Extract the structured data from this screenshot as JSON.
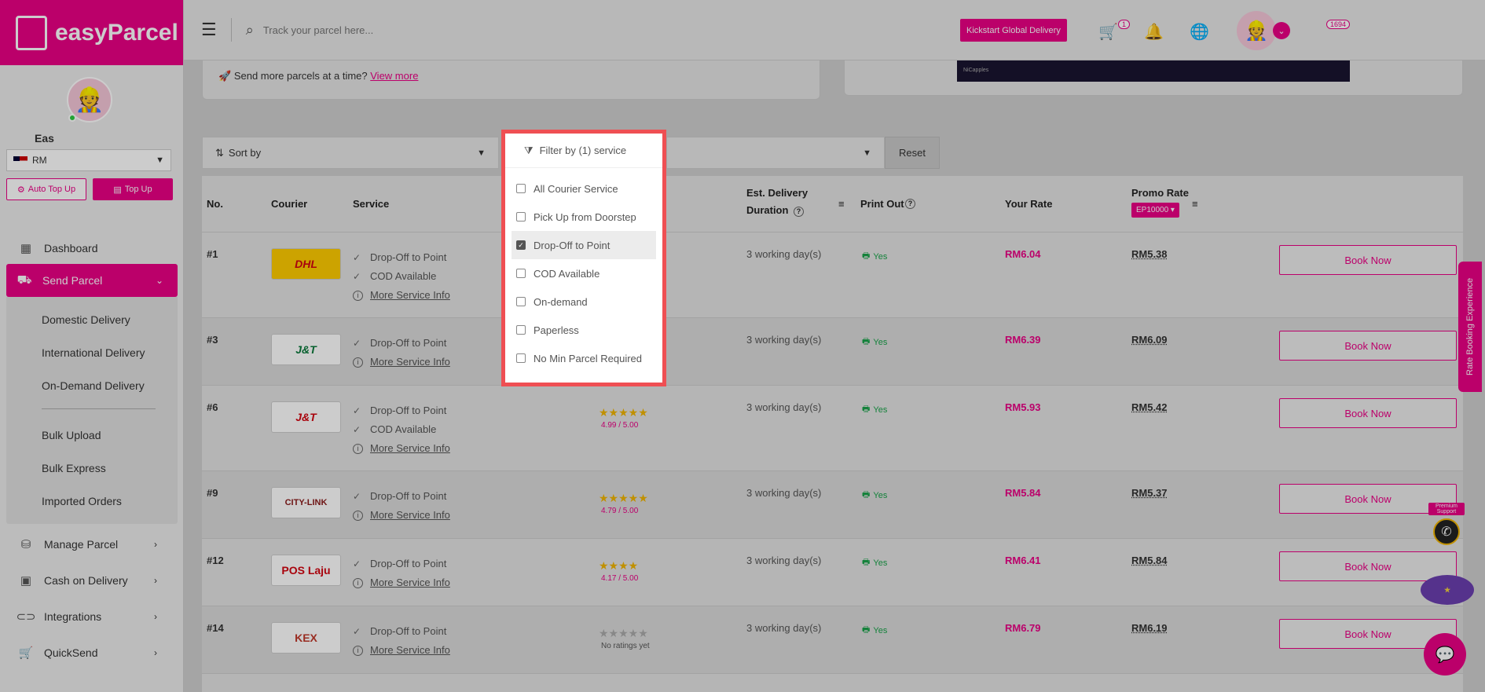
{
  "header": {
    "brand": "easyParcel",
    "search_placeholder": "Track your parcel here...",
    "kickstart_label": "Kickstart Global Delivery",
    "cart_count": "1",
    "notification_count": "1694"
  },
  "sidebar": {
    "user_name": "Eas",
    "currency": "RM",
    "auto_topup": "Auto Top Up",
    "topup": "Top Up",
    "items": [
      {
        "label": "Dashboard"
      },
      {
        "label": "Send Parcel"
      },
      {
        "label": "Manage Parcel"
      },
      {
        "label": "Cash on Delivery"
      },
      {
        "label": "Integrations"
      },
      {
        "label": "QuickSend"
      }
    ],
    "sub_items": [
      {
        "label": "Domestic Delivery"
      },
      {
        "label": "International Delivery"
      },
      {
        "label": "On-Demand Delivery"
      },
      {
        "label": "Bulk Upload"
      },
      {
        "label": "Bulk Express"
      },
      {
        "label": "Imported Orders"
      }
    ]
  },
  "bulk_note": {
    "text": "Send more parcels at a time?",
    "link": "View more"
  },
  "banner_text": "NiCapples",
  "toolbar": {
    "sort_label": "Sort by",
    "reset_label": "Reset"
  },
  "filter": {
    "label": "Filter by (1) service",
    "options": [
      {
        "label": "All Courier Service",
        "checked": false
      },
      {
        "label": "Pick Up from Doorstep",
        "checked": false
      },
      {
        "label": "Drop-Off to Point",
        "checked": true
      },
      {
        "label": "COD Available",
        "checked": false
      },
      {
        "label": "On-demand",
        "checked": false
      },
      {
        "label": "Paperless",
        "checked": false
      },
      {
        "label": "No Min Parcel Required",
        "checked": false
      }
    ]
  },
  "table": {
    "headers": {
      "no": "No.",
      "courier": "Courier",
      "service": "Service",
      "est1": "Est. Delivery",
      "est2": "Duration",
      "print": "Print Out",
      "rate": "Your Rate",
      "promo": "Promo Rate",
      "promo_code": "EP10000"
    },
    "rows": [
      {
        "no": "#1",
        "courier": "DHL eCommerce",
        "services": [
          "Drop-Off to Point",
          "COD Available"
        ],
        "more": "More Service Info",
        "stars": "",
        "rating": "",
        "duration": "3 working day(s)",
        "print": "Yes",
        "rate": "RM6.04",
        "promo": "RM5.38",
        "book": "Book Now"
      },
      {
        "no": "#3",
        "courier": "J&T CARGO",
        "services": [
          "Drop-Off to Point"
        ],
        "more": "More Service Info",
        "stars": "",
        "rating": "",
        "duration": "3 working day(s)",
        "print": "Yes",
        "rate": "RM6.39",
        "promo": "RM6.09",
        "book": "Book Now"
      },
      {
        "no": "#6",
        "courier": "J&T EXPRESS",
        "services": [
          "Drop-Off to Point",
          "COD Available"
        ],
        "more": "More Service Info",
        "stars": "★★★★★",
        "rating": "4.99 / 5.00",
        "duration": "3 working day(s)",
        "print": "Yes",
        "rate": "RM5.93",
        "promo": "RM5.42",
        "book": "Book Now"
      },
      {
        "no": "#9",
        "courier": "CITY-LINK",
        "services": [
          "Drop-Off to Point"
        ],
        "more": "More Service Info",
        "stars": "★★★★★",
        "rating": "4.79 / 5.00",
        "duration": "3 working day(s)",
        "print": "Yes",
        "rate": "RM5.84",
        "promo": "RM5.37",
        "book": "Book Now"
      },
      {
        "no": "#12",
        "courier": "POS Laju",
        "services": [
          "Drop-Off to Point"
        ],
        "more": "More Service Info",
        "stars": "★★★★",
        "rating": "4.17 / 5.00",
        "duration": "3 working day(s)",
        "print": "Yes",
        "rate": "RM6.41",
        "promo": "RM5.84",
        "book": "Book Now"
      },
      {
        "no": "#14",
        "courier": "KEX",
        "services": [
          "Drop-Off to Point"
        ],
        "more": "More Service Info",
        "stars": "",
        "rating": "No ratings yet",
        "duration": "3 working day(s)",
        "print": "Yes",
        "rate": "RM6.79",
        "promo": "RM6.19",
        "book": "Book Now"
      }
    ]
  },
  "side_tab": "Rate Booking Experience",
  "premium_label": "Premium Support",
  "colors": {
    "brand": "#ea0085",
    "highlight": "#ef4f53",
    "success": "#1aa34a"
  }
}
